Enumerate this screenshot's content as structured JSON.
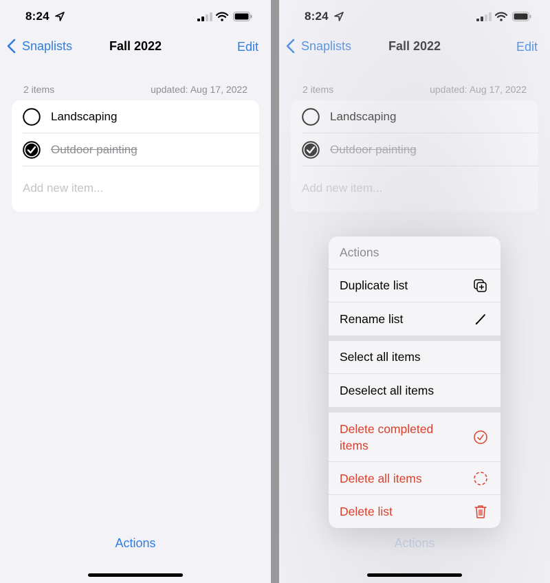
{
  "status_bar": {
    "time": "8:24"
  },
  "nav": {
    "back_label": "Snaplists",
    "title": "Fall 2022",
    "edit_label": "Edit"
  },
  "list_meta": {
    "count": "2 items",
    "updated": "updated: Aug 17, 2022"
  },
  "items": [
    {
      "label": "Landscaping",
      "checked": false
    },
    {
      "label": "Outdoor painting",
      "checked": true
    }
  ],
  "add_item": {
    "placeholder": "Add new item..."
  },
  "bottom": {
    "actions_label": "Actions"
  },
  "menu": {
    "header": "Actions",
    "items": [
      {
        "label": "Duplicate list",
        "icon": "duplicate-icon",
        "destructive": false
      },
      {
        "label": "Rename list",
        "icon": "pencil-icon",
        "destructive": false
      },
      {
        "label": "Select all items",
        "icon": null,
        "destructive": false
      },
      {
        "label": "Deselect all items",
        "icon": null,
        "destructive": false
      },
      {
        "label": "Delete completed items",
        "icon": "check-circle-icon",
        "destructive": true
      },
      {
        "label": "Delete all items",
        "icon": "dashed-circle-icon",
        "destructive": true
      },
      {
        "label": "Delete list",
        "icon": "trash-icon",
        "destructive": true
      }
    ]
  },
  "colors": {
    "accent": "#2f7de1",
    "destructive": "#d8402f",
    "background": "#f2f2f7",
    "secondary_text": "#8e8e93"
  }
}
